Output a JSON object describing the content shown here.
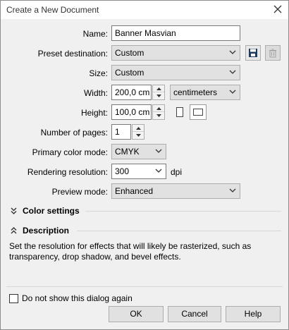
{
  "window": {
    "title": "Create a New Document"
  },
  "fields": {
    "name": {
      "label": "Name:",
      "value": "Banner Masvian"
    },
    "preset": {
      "label": "Preset destination:",
      "value": "Custom"
    },
    "size": {
      "label": "Size:",
      "value": "Custom"
    },
    "width": {
      "label": "Width:",
      "value": "200,0 cm",
      "unit": "centimeters"
    },
    "height": {
      "label": "Height:",
      "value": "100,0 cm"
    },
    "pages": {
      "label": "Number of pages:",
      "value": "1"
    },
    "color_mode": {
      "label": "Primary color mode:",
      "value": "CMYK"
    },
    "resolution": {
      "label": "Rendering resolution:",
      "value": "300",
      "unit": "dpi"
    },
    "preview": {
      "label": "Preview mode:",
      "value": "Enhanced"
    }
  },
  "sections": {
    "color_settings": "Color settings",
    "description": "Description"
  },
  "description_text": "Set the resolution for effects that will likely be rasterized, such as transparency, drop shadow, and bevel effects.",
  "footer": {
    "checkbox_label": "Do not show this dialog again",
    "ok": "OK",
    "cancel": "Cancel",
    "help": "Help"
  },
  "icons": {
    "close": "close-icon",
    "save_preset": "save-icon",
    "delete_preset": "trash-icon",
    "portrait": "portrait-icon",
    "landscape": "landscape-icon",
    "collapse_expand": "double-chevron-icon"
  }
}
